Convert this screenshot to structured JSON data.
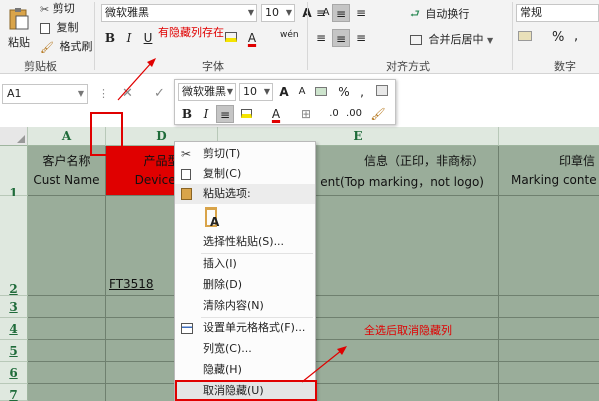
{
  "ribbon": {
    "clipboard": {
      "cut": "剪切",
      "paste": "粘贴",
      "copy": "复制",
      "format_painter": "格式刷",
      "group": "剪贴板"
    },
    "font": {
      "name": "微软雅黑",
      "size": "10",
      "grow": "A",
      "shrink": "A",
      "bold": "B",
      "italic": "I",
      "underline": "U",
      "pinyin": "wén",
      "group": "字体"
    },
    "alignment": {
      "wrap": "自动换行",
      "merge": "合并后居中",
      "group": "对齐方式"
    },
    "number": {
      "format": "常规",
      "percent": "%",
      "comma": ",",
      "group": "数字"
    }
  },
  "formula_bar": {
    "name_box": "A1",
    "fx": "fx"
  },
  "columns": [
    {
      "letter": "A"
    },
    {
      "letter": "D"
    },
    {
      "letter": "E"
    }
  ],
  "rows": [
    "1",
    "2",
    "3",
    "4",
    "5",
    "6",
    "7"
  ],
  "cells": {
    "a1_line1": "客户名称",
    "a1_line2": "Cust Name",
    "d1_line1": "产品型",
    "d1_line2": "Device N",
    "e1_line1": "信息（正印，非商标）",
    "e1_line2": "ent(Top marking，not logo)",
    "f1_line1": "印章信",
    "f1_line2": "Marking conte",
    "d2": "FT3518"
  },
  "mini_toolbar": {
    "font": "微软雅黑",
    "size": "10",
    "percent": "%",
    "comma": ","
  },
  "context_menu": {
    "cut": "剪切(T)",
    "copy": "复制(C)",
    "paste_options": "粘贴选项:",
    "paste_special": "选择性粘贴(S)...",
    "insert": "插入(I)",
    "delete": "删除(D)",
    "clear": "清除内容(N)",
    "format_cells": "设置单元格格式(F)...",
    "col_width": "列宽(C)...",
    "hide": "隐藏(H)",
    "unhide": "取消隐藏(U)"
  },
  "annotations": {
    "hidden_cols": "有隐藏列存在",
    "unhide_tip": "全选后取消隐藏列"
  },
  "colors": {
    "accent_red": "#e00000",
    "grid_fill": "#9aad9a",
    "header_fill": "#dfe8df"
  }
}
